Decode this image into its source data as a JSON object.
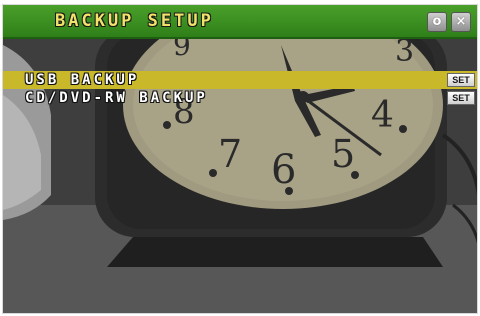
{
  "window": {
    "title": "BACKUP SETUP",
    "confirm_icon": "circle-confirm-icon",
    "close_icon": "x-close-icon",
    "confirm_glyph": "o",
    "close_glyph": "×"
  },
  "menu": {
    "items": [
      {
        "label": "USB BACKUP",
        "button": "SET",
        "selected": true
      },
      {
        "label": "CD/DVD-RW BACKUP",
        "button": "SET",
        "selected": false
      }
    ]
  },
  "colors": {
    "title_bar": "#3a9020",
    "title_text": "#f1e26a",
    "selection": "#c8b82a"
  }
}
